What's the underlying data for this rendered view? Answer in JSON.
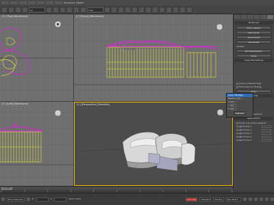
{
  "menubar": {
    "title": "Workspace: Default"
  },
  "toolbar": {
    "selection_filter": "All",
    "view_dropdown": "View"
  },
  "viewports": {
    "top_left": {
      "label": "[+] [Top] [Wireframe]"
    },
    "top_right": {
      "label": "[+] [Front] [Wireframe]"
    },
    "bottom_left": {
      "label": "[+] [Left] [Wireframe]"
    },
    "bottom_right": {
      "label": "[+] [Perspective] [Realistic]"
    }
  },
  "command_panel": {
    "header": "MAXScript",
    "buttons": [
      "Open Listener",
      "New Script",
      "Open Script",
      "Run Script",
      "Utilities",
      "Close"
    ],
    "dropdown": "Dot Visualization",
    "utility_title": "ViewCube Settings",
    "visibility_title": "Visibility",
    "show_label": "Show For Active View",
    "checks": [
      "Show the ViewCube",
      "Show In All Views",
      "Hide in Clipped Views"
    ],
    "section_display": "Display Options",
    "check_display": [
      "Snap to Nearest View",
      "Fit-to-View on Change",
      "Orbit Around Selection"
    ],
    "radio": [
      "Hide Floor 1",
      "Hide Floor 2",
      "Hide Roof",
      "Hide Walls"
    ],
    "btn_collapse": "Collapse",
    "btn_close": "Close",
    "options_title": "Optimization",
    "options_line": "Show only active viewport",
    "spinners": [
      "Single Frame 1",
      "Single Frame 2",
      "Single Frame 3",
      "Single Frame 4",
      "Single Frame 5"
    ]
  },
  "floater": {
    "title": "Layer Manager",
    "rows": [
      {
        "label": "Position",
        "value": "0.0"
      },
      {
        "label": "X",
        "value": "0.0"
      },
      {
        "label": "Y",
        "value": "0.0"
      },
      {
        "label": "Z",
        "value": "0.0"
      }
    ],
    "collapse": "Collapse"
  },
  "timeline": {
    "frame": "0 / 100",
    "ticks": [
      "0",
      "10",
      "20",
      "30",
      "40",
      "50",
      "60",
      "70",
      "80",
      "90",
      "100"
    ]
  },
  "status": {
    "selection": "None Selected",
    "x_field": "X:",
    "y_field": "Y:",
    "grid": "Grid = 10.0",
    "autokey": "Auto Key",
    "set_key": "Set Key",
    "selected": "Selected",
    "key_filters": "Key Filters..."
  },
  "colors": {
    "wire_magenta": "#e21ee2",
    "wire_yellow": "#e8e83a",
    "active_border": "#f0c000",
    "grid": "#7d7d7d"
  }
}
